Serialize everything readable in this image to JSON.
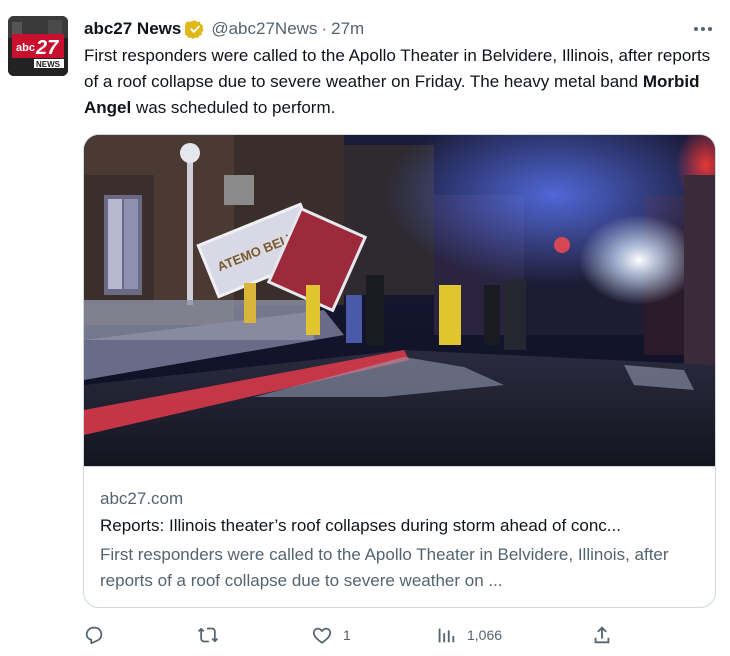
{
  "account": {
    "name": "abc27 News",
    "handle": "@abc27News",
    "separator": "·",
    "time": "27m",
    "avatar_text_top": "abc",
    "avatar_text_num": "27",
    "avatar_text_bottom": "NEWS"
  },
  "tweet": {
    "text_before": "First responders were called to the Apollo Theater in Belvidere, Illinois, after reports of a roof collapse due to severe weather on Friday. The heavy metal band ",
    "text_bold": "Morbid Angel",
    "text_after": " was scheduled to perform."
  },
  "card": {
    "domain": "abc27.com",
    "title": "Reports: Illinois theater’s roof collapses during storm ahead of conc...",
    "description": "First responders were called to the Apollo Theater in Belvidere, Illinois, after reports of a roof collapse due to severe weather on ...",
    "image_sign_text": "ATEMO BELV",
    "image_alt": "Night scene of a collapsed theater roof with emergency vehicles and debris"
  },
  "actions": {
    "reply_count": "",
    "retweet_count": "",
    "like_count": "1",
    "views_count": "1,066"
  },
  "icons": {
    "verified": "verified-badge-icon",
    "more": "more-options-icon",
    "reply": "reply-icon",
    "retweet": "retweet-icon",
    "like": "heart-icon",
    "views": "views-chart-icon",
    "share": "share-icon"
  },
  "colors": {
    "text": "#0f1419",
    "secondary": "#536471",
    "border": "#cfd9de",
    "verified_gold": "#e2b719"
  }
}
